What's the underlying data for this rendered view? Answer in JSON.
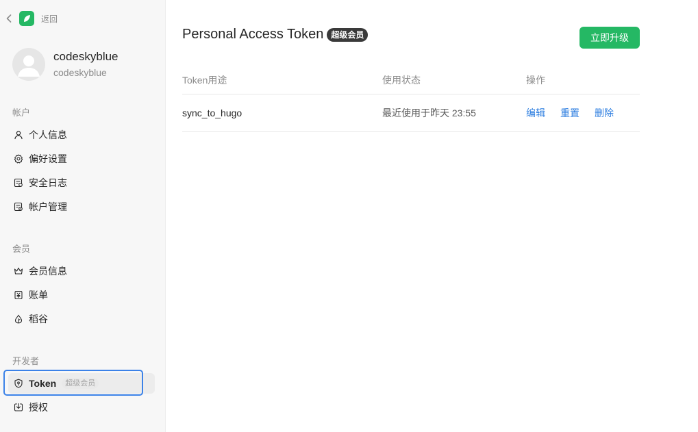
{
  "sidebar": {
    "back_label": "返回",
    "profile": {
      "name": "codeskyblue",
      "login": "codeskyblue"
    },
    "groups": [
      {
        "title": "帐户",
        "items": [
          {
            "label": "个人信息",
            "icon": "user-icon"
          },
          {
            "label": "偏好设置",
            "icon": "gear-icon"
          },
          {
            "label": "安全日志",
            "icon": "security-log-icon"
          },
          {
            "label": "帐户管理",
            "icon": "account-manage-icon"
          }
        ]
      },
      {
        "title": "会员",
        "items": [
          {
            "label": "会员信息",
            "icon": "crown-icon"
          },
          {
            "label": "账单",
            "icon": "yen-bill-icon"
          },
          {
            "label": "稻谷",
            "icon": "drop-icon"
          }
        ]
      },
      {
        "title": "开发者",
        "items": [
          {
            "label": "Token",
            "icon": "shield-icon",
            "badge": "超级会员",
            "active": true
          },
          {
            "label": "授权",
            "icon": "authorize-icon"
          }
        ]
      }
    ]
  },
  "main": {
    "title": "Personal Access Token",
    "title_badge": "超级会员",
    "upgrade_label": "立即升级",
    "table": {
      "headers": [
        "Token用途",
        "使用状态",
        "操作"
      ],
      "rows": [
        {
          "purpose": "sync_to_hugo",
          "status": "最近使用于昨天 23:55",
          "actions": [
            "编辑",
            "重置",
            "删除"
          ]
        }
      ]
    }
  },
  "colors": {
    "accent_green": "#25b864",
    "link_blue": "#2f7fe0",
    "highlight_blue": "#3b82e8",
    "badge_dark": "#3a3a3a"
  }
}
